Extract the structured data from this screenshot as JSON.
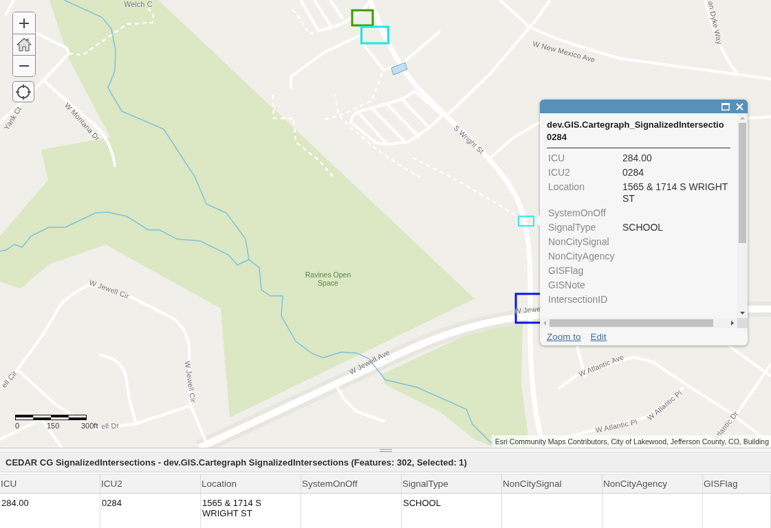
{
  "map": {
    "labels": [
      "Welch C",
      "Yank Ct",
      "W Montana Dr",
      "W New Mexico Ave",
      "an Dyke Way",
      "S Wright St",
      "W Jewell Cir",
      "W Jewell Cir",
      "ell Cir",
      "W Jewell Ave",
      "ell Dr",
      "W Jewe",
      "W Atlantic Ave",
      "W Atlantic Pl",
      "W Atlantic Pl",
      "Atlantic Dr"
    ],
    "park_label": "Ravines Open Space",
    "scale_bar": [
      "0",
      "150",
      "300ft"
    ],
    "attribution": "Esri Community Maps Contributors, City of Lakewood, Jefferson County, CO, Building"
  },
  "popup": {
    "title": "dev.GIS.Cartegraph_SignalizedIntersectio 0284",
    "fields": [
      {
        "label": "ICU",
        "value": "284.00"
      },
      {
        "label": "ICU2",
        "value": "0284"
      },
      {
        "label": "Location",
        "value": "1565 & 1714 S WRIGHT ST"
      },
      {
        "label": "SystemOnOff"
      },
      {
        "label": "SignalType",
        "value": "SCHOOL"
      },
      {
        "label": "NonCitySignal"
      },
      {
        "label": "NonCityAgency"
      },
      {
        "label": "GISFlag"
      },
      {
        "label": "GISNote"
      },
      {
        "label": "IntersectionID"
      }
    ],
    "links": [
      "Zoom to",
      "Edit"
    ]
  },
  "attribute_table": {
    "title": "CEDAR CG SignalizedIntersections - dev.GIS.Cartegraph SignalizedIntersections (Features: 302, Selected: 1)",
    "columns": [
      "ICU",
      "ICU2",
      "Location",
      "SystemOnOff",
      "SignalType",
      "NonCitySignal",
      "NonCityAgency",
      "GISFlag"
    ],
    "rows": [
      [
        "284.00",
        "0284",
        "1565 & 1714 S WRIGHT ST",
        null,
        "SCHOOL",
        null,
        null,
        null
      ]
    ]
  }
}
